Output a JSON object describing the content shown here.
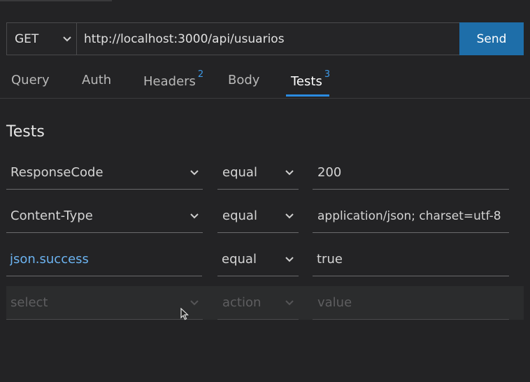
{
  "request": {
    "method": "GET",
    "url": "http://localhost:3000/api/usuarios",
    "send_label": "Send"
  },
  "tabs": [
    {
      "label": "Query",
      "badge": ""
    },
    {
      "label": "Auth",
      "badge": ""
    },
    {
      "label": "Headers",
      "badge": "2"
    },
    {
      "label": "Body",
      "badge": ""
    },
    {
      "label": "Tests",
      "badge": "3",
      "active": true
    }
  ],
  "tests": {
    "title": "Tests",
    "rows": [
      {
        "select": "ResponseCode",
        "action": "equal",
        "value": "200"
      },
      {
        "select": "Content-Type",
        "action": "equal",
        "value": "application/json; charset=utf-8"
      },
      {
        "select": "json.success",
        "action": "equal",
        "value": "true"
      }
    ],
    "new_row": {
      "select_placeholder": "select",
      "action_placeholder": "action",
      "value_placeholder": "value"
    }
  },
  "colors": {
    "accent": "#1e6ea9",
    "tab_underline": "#2a8be0",
    "badge": "#3d9ae8",
    "link": "#6cb3f0"
  }
}
